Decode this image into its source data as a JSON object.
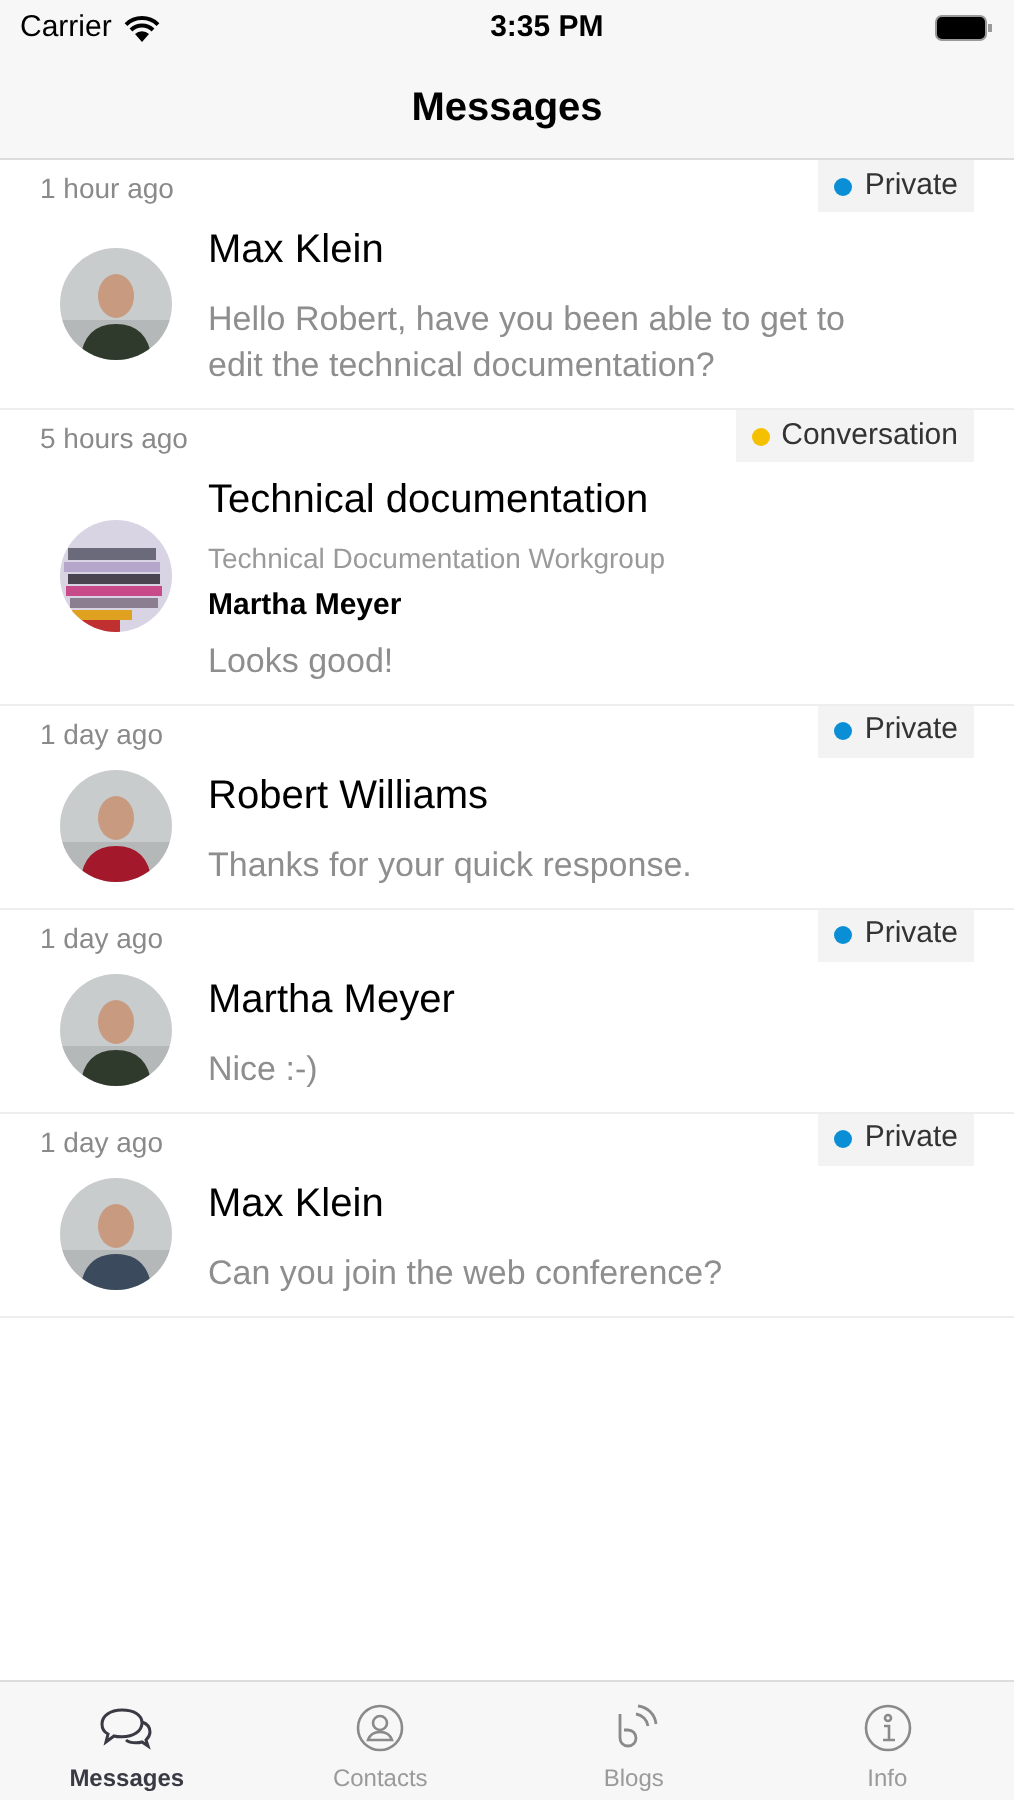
{
  "status_bar": {
    "carrier": "Carrier",
    "time": "3:35 PM"
  },
  "nav": {
    "title": "Messages"
  },
  "messages": [
    {
      "time": "1 hour ago",
      "tag": {
        "label": "Private",
        "color": "#0a8fd6"
      },
      "title": "Max Klein",
      "text": "Hello Robert, have you been able to get to edit the technical documentation?"
    },
    {
      "time": "5 hours ago",
      "tag": {
        "label": "Conversation",
        "color": "#f5c000"
      },
      "title": "Technical documentation",
      "group": "Technical Documentation Workgroup",
      "sender": "Martha Meyer",
      "text": "Looks good!"
    },
    {
      "time": "1 day ago",
      "tag": {
        "label": "Private",
        "color": "#0a8fd6"
      },
      "title": "Robert Williams",
      "text": "Thanks for your quick response."
    },
    {
      "time": "1 day ago",
      "tag": {
        "label": "Private",
        "color": "#0a8fd6"
      },
      "title": "Martha Meyer",
      "text": "Nice :-)"
    },
    {
      "time": "1 day ago",
      "tag": {
        "label": "Private",
        "color": "#0a8fd6"
      },
      "title": "Max Klein",
      "text": "Can you join the web conference?"
    }
  ],
  "tab_bar": [
    {
      "label": "Messages",
      "kind": "chat",
      "selected": true
    },
    {
      "label": "Contacts",
      "kind": "person",
      "selected": false
    },
    {
      "label": "Blogs",
      "kind": "blog",
      "selected": false
    },
    {
      "label": "Info",
      "kind": "info",
      "selected": false
    }
  ]
}
